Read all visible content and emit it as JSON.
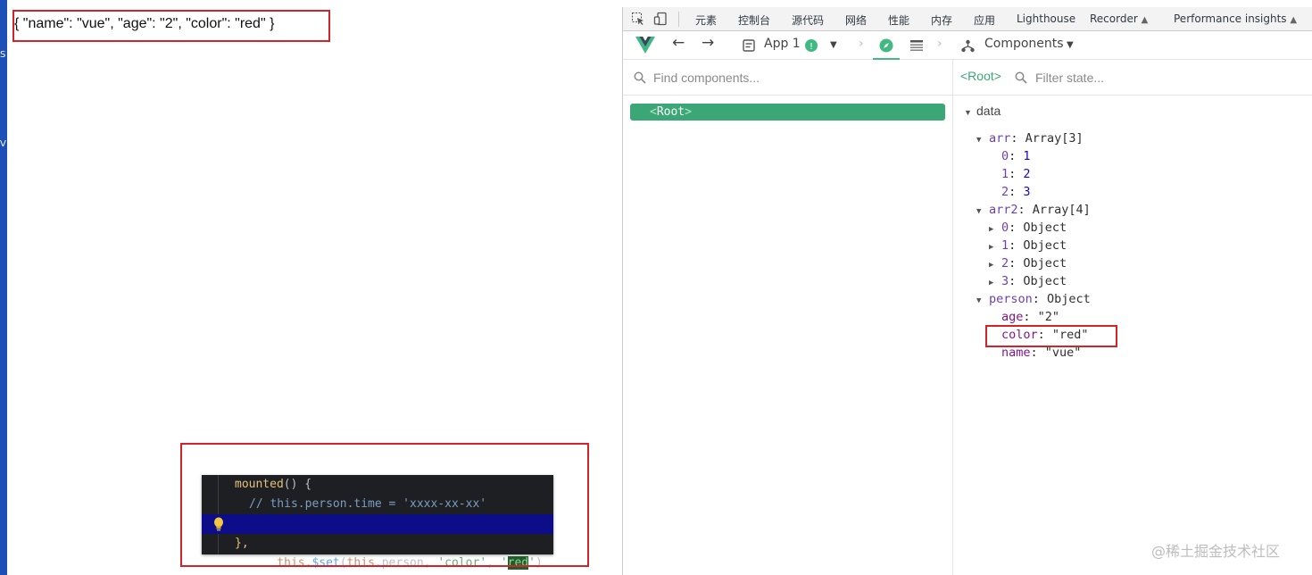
{
  "page": {
    "json_output": "{ \"name\": \"vue\", \"age\": \"2\", \"color\": \"red\" }"
  },
  "code": {
    "line1": {
      "fn": "mounted",
      "rest": "() {"
    },
    "line2": {
      "comment": "// this.person.time = 'xxxx-xx-xx'"
    },
    "line3": {
      "a": "this",
      "b": ".",
      "m": "$set",
      "c": "(",
      "d": "this",
      "e": ".person, ",
      "s1": "'color'",
      "f": ", ",
      "s2a": "'",
      "s2b": "red",
      "s2c": "'",
      "g": ")"
    },
    "line4": {
      "text": "},"
    }
  },
  "devtools": {
    "tabs": [
      "元素",
      "控制台",
      "源代码",
      "网络",
      "性能",
      "内存",
      "应用",
      "Lighthouse",
      "Recorder",
      "Performance insights"
    ],
    "vue_bar": {
      "app_label": "App 1",
      "components_label": "Components"
    },
    "component_search": {
      "placeholder": "Find components..."
    },
    "root_component": {
      "lt": "<",
      "name": "Root",
      "gt": ">"
    },
    "state_header": {
      "root_label": "<Root>",
      "filter_placeholder": "Filter state..."
    },
    "state": {
      "section": "data",
      "arr": {
        "key": "arr",
        "type": "Array[3]",
        "items": [
          [
            "0",
            "1"
          ],
          [
            "1",
            "2"
          ],
          [
            "2",
            "3"
          ]
        ]
      },
      "arr2": {
        "key": "arr2",
        "type": "Array[4]",
        "items": [
          [
            "0",
            "Object"
          ],
          [
            "1",
            "Object"
          ],
          [
            "2",
            "Object"
          ],
          [
            "3",
            "Object"
          ]
        ]
      },
      "person": {
        "key": "person",
        "type": "Object",
        "fields": [
          [
            "age",
            "\"2\""
          ],
          [
            "color",
            "\"red\""
          ],
          [
            "name",
            "\"vue\""
          ]
        ]
      }
    }
  },
  "watermark": "@稀土掘金技术社区",
  "colors": {
    "vue_green": "#3ba776",
    "annotation_red": "#d2232a"
  }
}
